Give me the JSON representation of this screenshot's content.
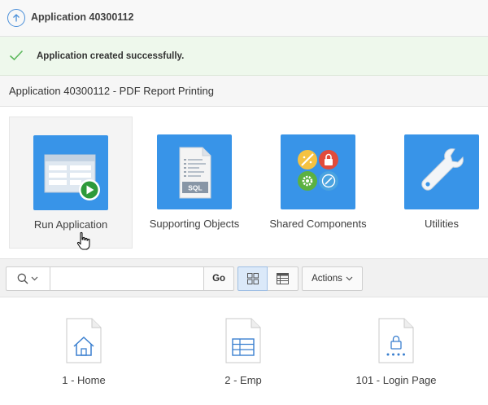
{
  "topbar": {
    "title": "Application 40300112",
    "up_icon": "arrow-up-circle-icon"
  },
  "success": {
    "message": "Application created successfully.",
    "icon": "checkmark-icon",
    "accent": "#5cb85c"
  },
  "region": {
    "title": "Application 40300112 - PDF Report Printing"
  },
  "tiles": [
    {
      "label": "Run Application",
      "icon": "run-application-icon"
    },
    {
      "label": "Supporting Objects",
      "icon": "sql-document-icon"
    },
    {
      "label": "Shared Components",
      "icon": "shared-components-icon"
    },
    {
      "label": "Utilities",
      "icon": "wrench-icon"
    }
  ],
  "toolbar": {
    "search_value": "",
    "go_label": "Go",
    "actions_label": "Actions",
    "view_icons": [
      "grid-view-icon",
      "report-view-icon"
    ]
  },
  "pages": [
    {
      "label": "1 - Home",
      "icon": "home-page-icon"
    },
    {
      "label": "2 - Emp",
      "icon": "table-page-icon"
    },
    {
      "label": "101 - Login Page",
      "icon": "login-page-icon"
    }
  ],
  "colors": {
    "tile_blue": "#3894e8",
    "success_bg": "#eef8ec",
    "link_blue": "#4a8fd9",
    "active_view_bg": "#dbe9f9"
  }
}
